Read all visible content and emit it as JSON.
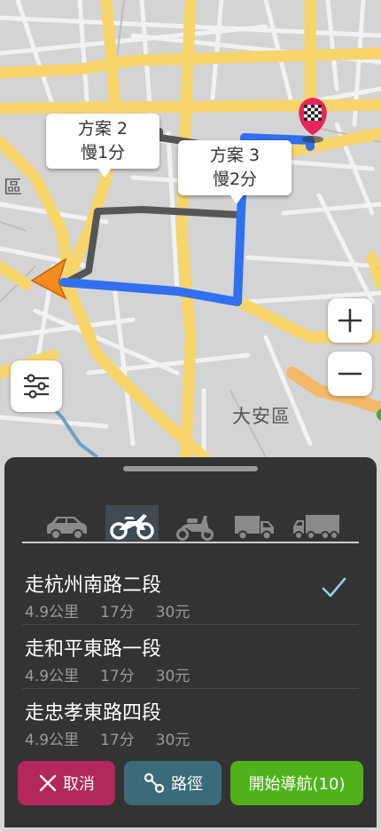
{
  "map": {
    "district_label": "大安區",
    "edge_label": "區",
    "callouts": [
      {
        "plan": "方案 2",
        "delay": "慢1分"
      },
      {
        "plan": "方案 3",
        "delay": "慢2分"
      }
    ]
  },
  "travel_modes": [
    {
      "icon": "car-icon",
      "selected": false
    },
    {
      "icon": "motorcycle-icon",
      "selected": true
    },
    {
      "icon": "scooter-icon",
      "selected": false
    },
    {
      "icon": "truck-icon",
      "selected": false
    },
    {
      "icon": "big-truck-icon",
      "selected": false
    }
  ],
  "routes": [
    {
      "name": "走杭州南路二段",
      "distance": "4.9公里",
      "time": "17分",
      "cost": "30元",
      "selected": true
    },
    {
      "name": "走和平東路一段",
      "distance": "4.9公里",
      "time": "17分",
      "cost": "30元",
      "selected": false
    },
    {
      "name": "走忠孝東路四段",
      "distance": "4.9公里",
      "time": "17分",
      "cost": "30元",
      "selected": false
    }
  ],
  "buttons": {
    "cancel": "取消",
    "route": "路徑",
    "start": "開始導航(10)"
  },
  "colors": {
    "panel": "#333333",
    "cancel": "#b3275a",
    "route": "#3b6b78",
    "start": "#4fb21a",
    "selected_route": "#2f6ff0",
    "alt_route": "#555555",
    "check": "#8fd3e8"
  }
}
